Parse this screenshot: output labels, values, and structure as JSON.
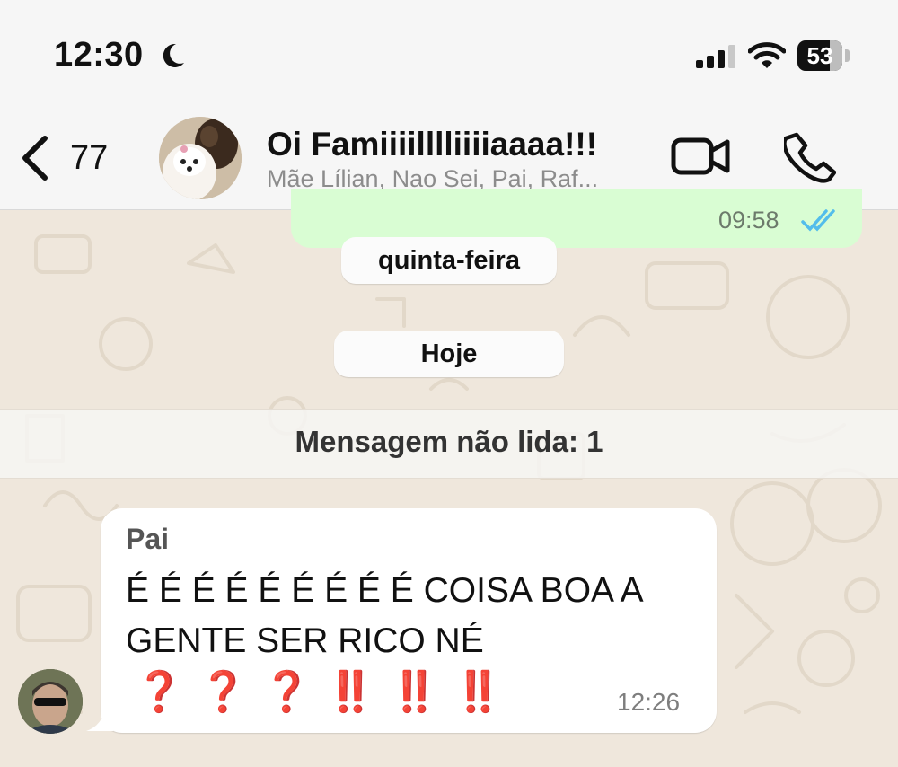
{
  "status_bar": {
    "time": "12:30",
    "moon_icon": "moon-icon",
    "signal_icon": "cellular-signal-icon",
    "wifi_icon": "wifi-icon",
    "battery_level": "53"
  },
  "header": {
    "back_count": "77",
    "title": "Oi Famiiiilllliiiiaaaa!!!",
    "subtitle": "Mãe Lílian, Nao Sei, Pai, Raf...",
    "video_icon": "video-camera-icon",
    "phone_icon": "phone-icon"
  },
  "colors": {
    "outgoing_bubble": "#d9fdd3",
    "read_ticks": "#53bdeb",
    "wallpaper": "#efe7dc",
    "emoji_red": "#d21a1a"
  },
  "messages": {
    "outgoing_time": "09:58",
    "day_separators": [
      "quinta-feira",
      "Hoje"
    ],
    "unread_banner": "Mensagem não lida: 1",
    "incoming": {
      "sender": "Pai",
      "line1": "É É É É É É É É É COISA BOA A",
      "line2": "GENTE SER RICO NÉ",
      "emojis": "❓ ❓ ❓ ‼️ ‼️ ‼️",
      "time": "12:26"
    }
  }
}
